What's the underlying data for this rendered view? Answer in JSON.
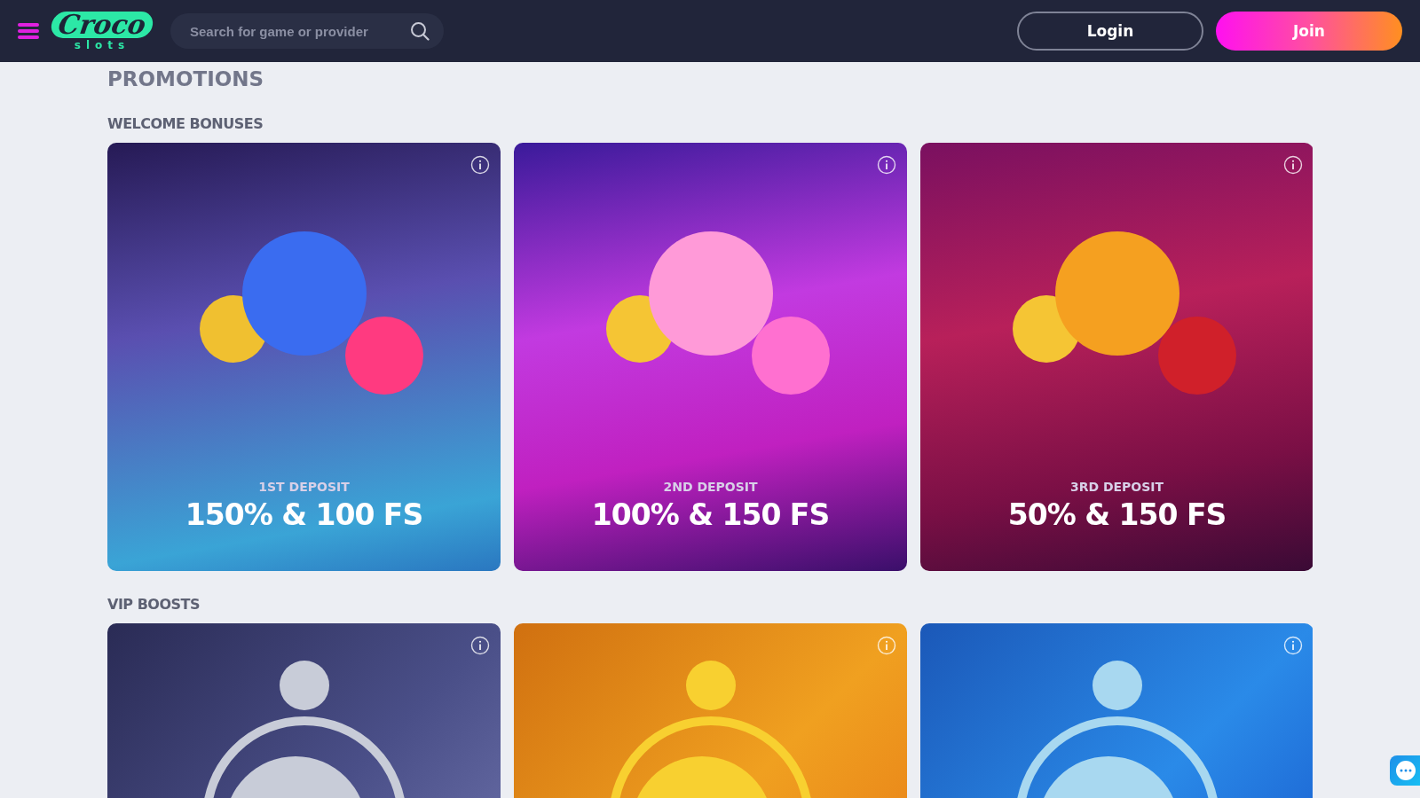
{
  "header": {
    "logo": {
      "name": "Croco",
      "tagline": "slots"
    },
    "search": {
      "placeholder": "Search for game or provider"
    },
    "buttons": [
      {
        "label": "Login",
        "kind": "outline"
      },
      {
        "label": "Join",
        "kind": "primary"
      }
    ]
  },
  "page_title": "PROMOTIONS",
  "sections": [
    {
      "title": "WELCOME BONUSES",
      "cards": [
        {
          "kind": "deposit",
          "subtitle": "1ST DEPOSIT",
          "title": "150% & 100 FS"
        },
        {
          "kind": "deposit",
          "subtitle": "2ND DEPOSIT",
          "title": "100% & 150 FS"
        },
        {
          "kind": "deposit",
          "subtitle": "3RD DEPOSIT",
          "title": "50% & 150 FS"
        }
      ]
    },
    {
      "title": "VIP BOOSTS",
      "cards": [
        {
          "kind": "boost"
        },
        {
          "kind": "boost"
        },
        {
          "kind": "boost"
        }
      ]
    }
  ]
}
